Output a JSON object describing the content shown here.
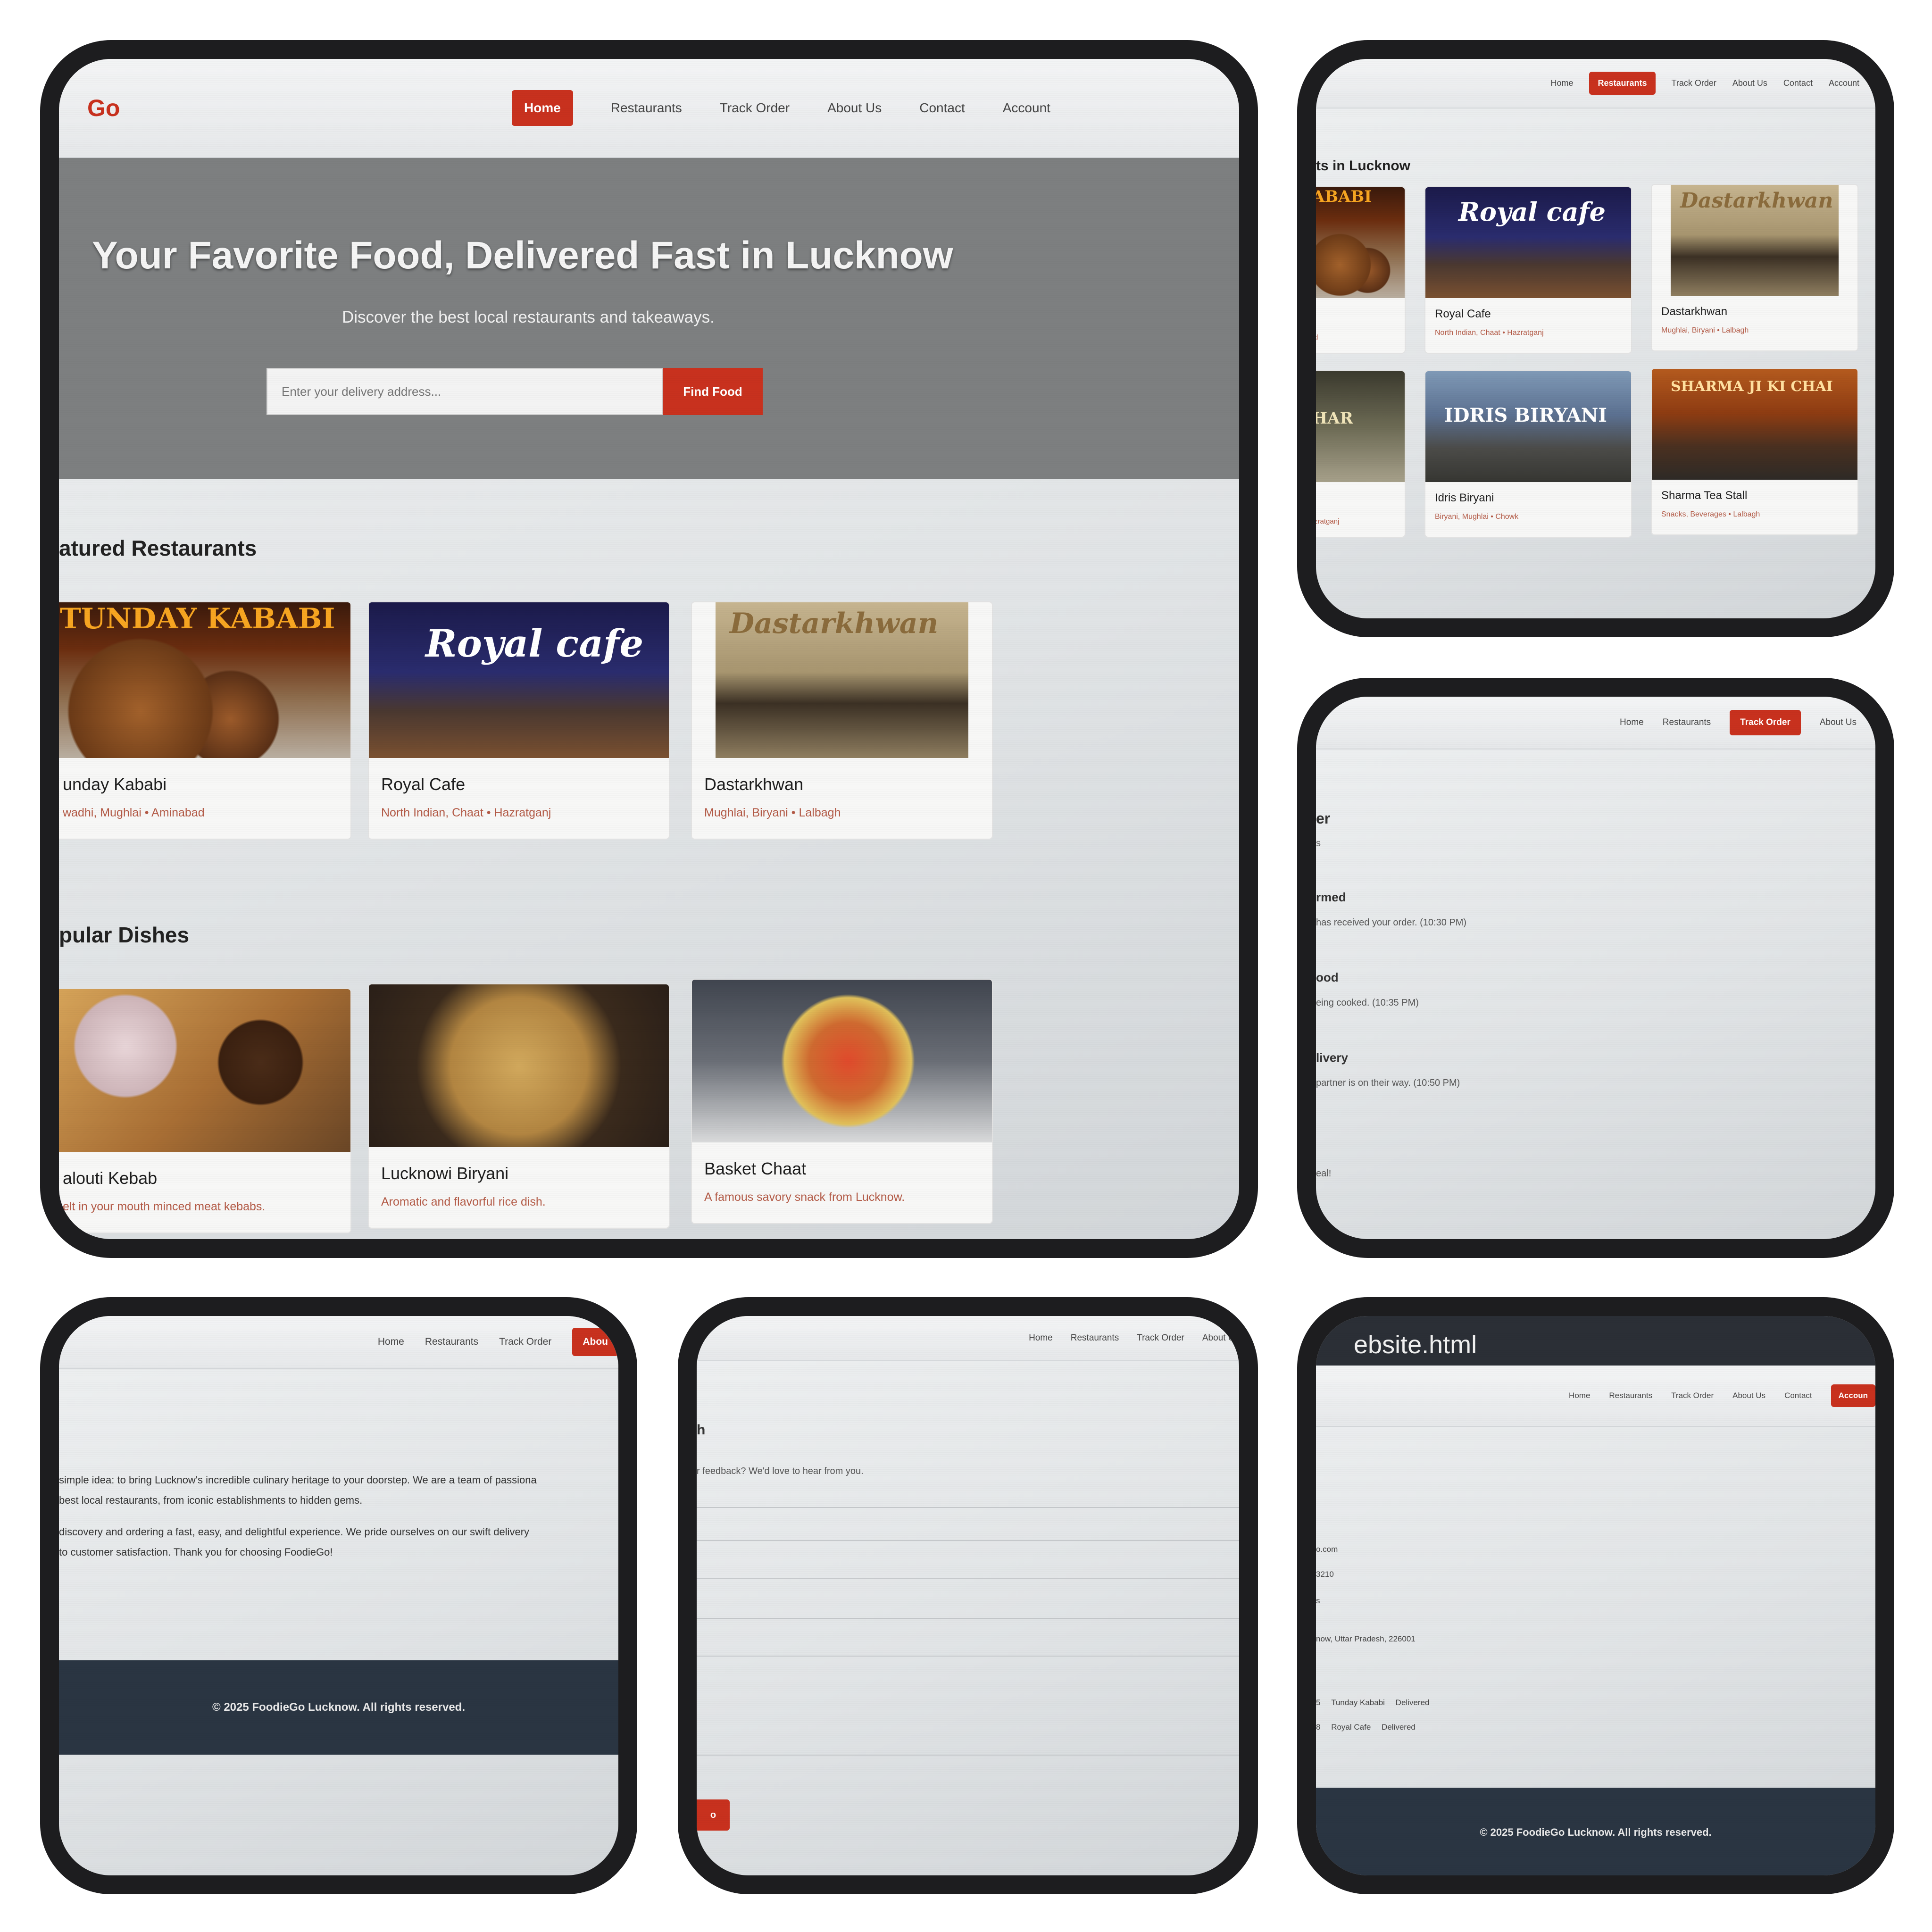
{
  "nav": {
    "logo": "Go",
    "links": [
      "Home",
      "Restaurants",
      "Track Order",
      "About Us",
      "Contact",
      "Account"
    ]
  },
  "home": {
    "hero_title": "Your Favorite Food, Delivered Fast in Lucknow",
    "hero_subtitle": "Discover the best local restaurants and takeaways.",
    "search_placeholder": "Enter your delivery address...",
    "search_button": "Find Food",
    "featured_title": "atured Restaurants",
    "featured": [
      {
        "name": "unday Kababi",
        "meta": "wadhi, Mughlai • Aminabad",
        "sign": "TUNDAY KABABI"
      },
      {
        "name": "Royal Cafe",
        "meta": "North Indian, Chaat • Hazratganj",
        "sign": "Royal cafe"
      },
      {
        "name": "Dastarkhwan",
        "meta": "Mughlai, Biryani • Lalbagh",
        "sign": "Dastarkhwan"
      }
    ],
    "dishes_title": "pular Dishes",
    "dishes": [
      {
        "name": "alouti Kebab",
        "desc": "elt in your mouth minced meat kebabs."
      },
      {
        "name": "Lucknowi Biryani",
        "desc": "Aromatic and flavorful rice dish."
      },
      {
        "name": "Basket Chaat",
        "desc": "A famous savory snack from Lucknow."
      }
    ]
  },
  "restaurants_page": {
    "title": "ts in Lucknow",
    "cards": [
      {
        "name": "",
        "meta": "d",
        "sign": "ABABI"
      },
      {
        "name": "Royal Cafe",
        "meta": "North Indian, Chaat • Hazratganj",
        "sign": "Royal cafe"
      },
      {
        "name": "Dastarkhwan",
        "meta": "Mughlai, Biryani • Lalbagh",
        "sign": "Dastarkhwan"
      },
      {
        "name": "",
        "meta": "zratganj",
        "sign": "HAR"
      },
      {
        "name": "Idris Biryani",
        "meta": "Biryani, Mughlai • Chowk",
        "sign": "IDRIS BIRYANI"
      },
      {
        "name": "Sharma Tea Stall",
        "meta": "Snacks, Beverages • Lalbagh",
        "sign": "SHARMA JI KI CHAI"
      }
    ]
  },
  "track_page": {
    "title": "er",
    "sub": "s",
    "steps": [
      {
        "title": "rmed",
        "desc": "has received your order. (10:30 PM)"
      },
      {
        "title": "ood",
        "desc": "eing cooked. (10:35 PM)"
      },
      {
        "title": "livery",
        "desc": "partner is on their way. (10:50 PM)"
      }
    ],
    "tail": "eal!"
  },
  "about_page": {
    "para1_line1": "simple idea: to bring Lucknow's incredible culinary heritage to your doorstep. We are a team of passiona",
    "para1_line2": "best local restaurants, from iconic establishments to hidden gems.",
    "para2_line1": "discovery and ordering a fast, easy, and delightful experience. We pride ourselves on our swift delivery",
    "para2_line2": "to customer satisfaction. Thank you for choosing FoodieGo!",
    "footer": "© 2025 FoodieGo Lucknow. All rights reserved.",
    "active_tab": "Abou"
  },
  "contact_page": {
    "title": "h",
    "intro": "r feedback? We'd love to hear from you.",
    "button": "o"
  },
  "account_page": {
    "window_title": "ebsite.html",
    "email": "o.com",
    "phone": "3210",
    "mark": "s",
    "address": "now, Uttar Pradesh, 226001",
    "orders": [
      {
        "prefix": "5",
        "restaurant": "Tunday Kababi",
        "status": "Delivered"
      },
      {
        "prefix": "8",
        "restaurant": "Royal Cafe",
        "status": "Delivered"
      }
    ],
    "footer": "© 2025 FoodieGo Lucknow. All rights reserved.",
    "active_tab": "Accoun"
  }
}
